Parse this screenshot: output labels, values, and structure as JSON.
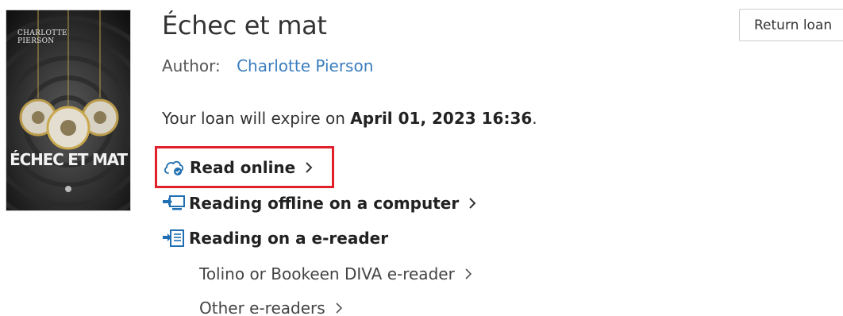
{
  "book": {
    "title": "Échec et mat",
    "author_label": "Author:",
    "author": "Charlotte Pierson",
    "cover": {
      "author_line1": "CHARLOTTE",
      "author_line2": "PIERSON",
      "title": "ÉCHEC ET MAT"
    }
  },
  "loan": {
    "expire_prefix": "Your loan will expire on ",
    "expire_date": "April 01, 2023 16:36",
    "expire_suffix": "."
  },
  "actions": {
    "return_label": "Return loan"
  },
  "reading_options": [
    {
      "label": "Read online",
      "icon": "cloud-icon",
      "highlighted": true
    },
    {
      "label": "Reading offline on a computer",
      "icon": "computer-download-icon"
    },
    {
      "label": "Reading on a e-reader",
      "icon": "ereader-icon"
    }
  ],
  "ereader_options": [
    {
      "label": "Tolino or Bookeen DIVA e-reader"
    },
    {
      "label": "Other e-readers"
    }
  ],
  "colors": {
    "link": "#3a7dbd",
    "icon": "#1f6fb2",
    "highlight": "#e0202a",
    "text": "#333333"
  }
}
